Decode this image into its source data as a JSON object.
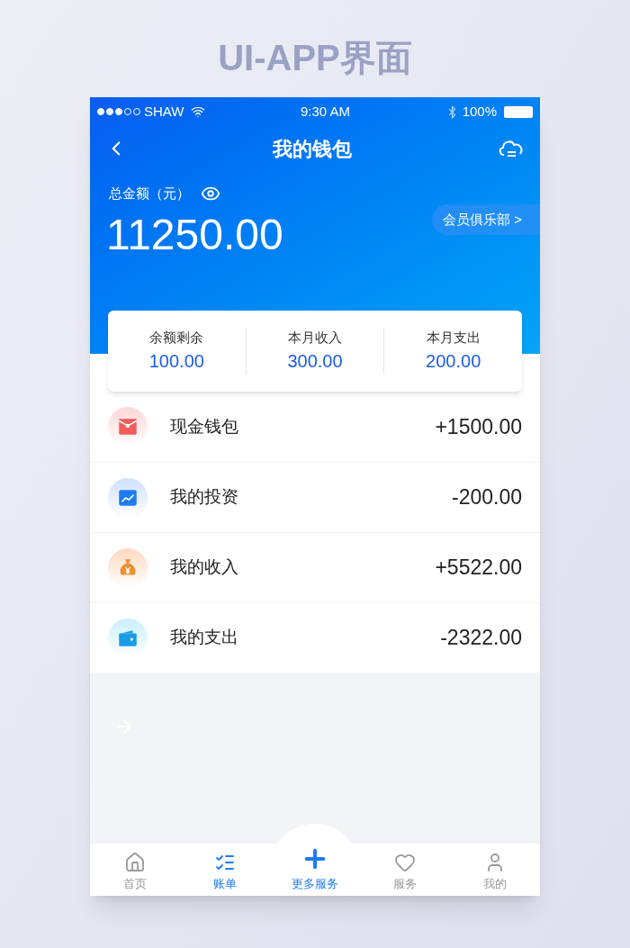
{
  "heading": "UI-APP界面",
  "status_bar": {
    "carrier": "SHAW",
    "time": "9:30 AM",
    "battery": "100%"
  },
  "nav": {
    "title": "我的钱包"
  },
  "balance": {
    "label": "总金额（元）",
    "amount": "11250.00",
    "club_link": "会员俱乐部 >"
  },
  "summary": [
    {
      "label": "余额剩余",
      "value": "100.00"
    },
    {
      "label": "本月收入",
      "value": "300.00"
    },
    {
      "label": "本月支出",
      "value": "200.00"
    }
  ],
  "accounts": [
    {
      "name": "现金钱包",
      "amount": "+1500.00",
      "color": "#f25c5c"
    },
    {
      "name": "我的投资",
      "amount": "-200.00",
      "color": "#1e7bf5"
    },
    {
      "name": "我的收入",
      "amount": "+5522.00",
      "color": "#ef8f2f"
    },
    {
      "name": "我的支出",
      "amount": "-2322.00",
      "color": "#1a9be6"
    }
  ],
  "tab_bar": [
    {
      "label": "首页",
      "kind": "tab",
      "selected": false
    },
    {
      "label": "账单",
      "kind": "tab",
      "selected": true
    },
    {
      "label": "更多服务",
      "kind": "center"
    },
    {
      "label": "服务",
      "kind": "tab",
      "selected": false
    },
    {
      "label": "我的",
      "kind": "tab",
      "selected": false
    }
  ]
}
